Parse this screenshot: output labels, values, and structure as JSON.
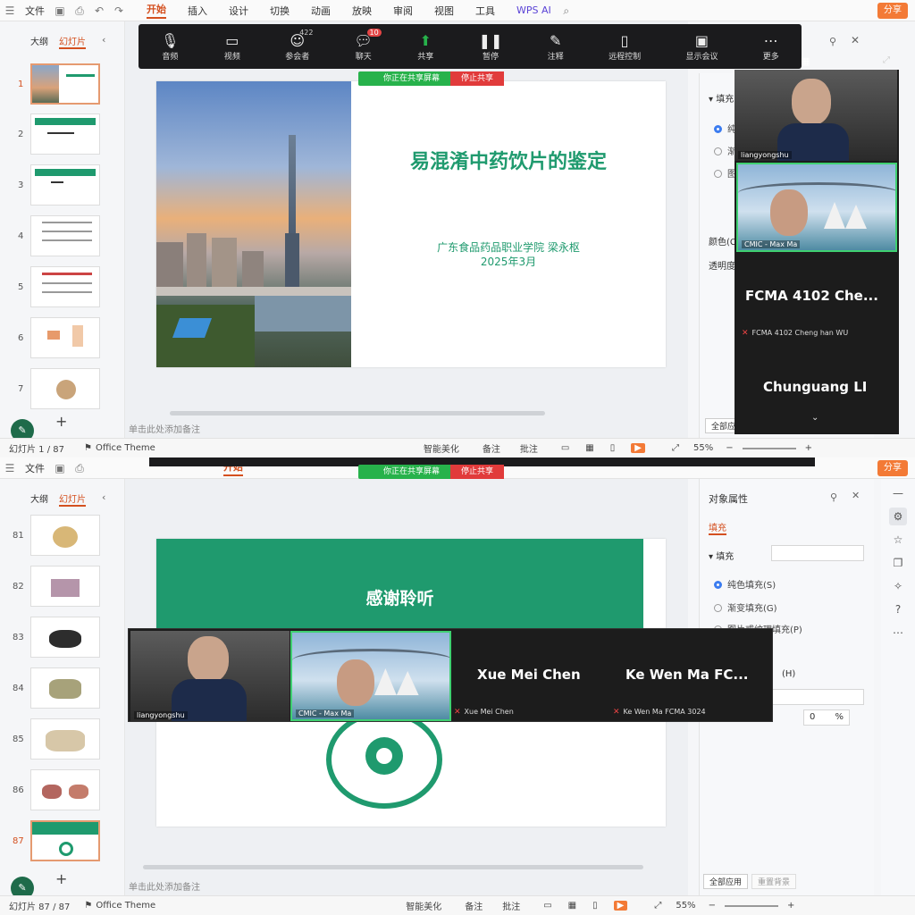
{
  "menubar": {
    "file": "文件",
    "items": [
      "开始",
      "插入",
      "设计",
      "切换",
      "动画",
      "放映",
      "审阅",
      "视图",
      "工具"
    ],
    "active": "开始",
    "wps_ai": "WPS AI",
    "share": "分享"
  },
  "sidebar": {
    "tab_outline": "大纲",
    "tab_slides": "幻灯片",
    "top_numbers": [
      "1",
      "2",
      "3",
      "4",
      "5",
      "6",
      "7"
    ],
    "bottom_numbers": [
      "81",
      "82",
      "83",
      "84",
      "85",
      "86",
      "87"
    ]
  },
  "zoom_toolbar": {
    "audio": "音频",
    "video": "视频",
    "participants": "参会者",
    "participants_count": "422",
    "chat": "聊天",
    "chat_badge": "10",
    "share": "共享",
    "pause": "暂停",
    "annotate": "注释",
    "remote": "远程控制",
    "show_meeting": "显示会议",
    "more": "更多"
  },
  "share_banner": {
    "sharing": "你正在共享屏幕",
    "stop": "停止共享"
  },
  "slide1": {
    "title": "易混淆中药饮片的鉴定",
    "org": "广东食品药品职业学院  梁永枢",
    "date": "2025年3月"
  },
  "slide87": {
    "title": "感谢聆听"
  },
  "notes_placeholder": "单击此处添加备注",
  "status_top": {
    "slide": "幻灯片 1 / 87",
    "theme": "Office Theme",
    "smart": "智能美化",
    "notes": "备注",
    "comment": "批注",
    "zoom": "55%"
  },
  "status_bottom": {
    "slide": "幻灯片 87 / 87",
    "theme": "Office Theme",
    "smart": "智能美化",
    "notes": "备注",
    "comment": "批注",
    "zoom": "55%"
  },
  "right_panel": {
    "title": "对象属性",
    "tab_fill": "填充",
    "section_fill": "填充",
    "opt_solid": "纯色填充(S)",
    "opt_gradient": "渐变填充(G)",
    "opt_picture": "图片或纹理填充(P)",
    "opt_h": "(H)",
    "color_label": "颜色(C)",
    "transparency_label": "透明度",
    "transparency_value": "0",
    "percent": "%",
    "apply_all": "全部应用",
    "reset_bg": "重置背景"
  },
  "participants_vertical": {
    "t1": "liangyongshu",
    "t2": "CMIC - Max Ma",
    "big3": "FCMA  4102  Che...",
    "small3": "FCMA 4102 Cheng han WU",
    "big4": "Chunguang LI"
  },
  "participants_horizontal": {
    "t1": "liangyongshu",
    "t2": "CMIC - Max Ma",
    "big3": "Xue Mei Chen",
    "small3": "Xue Mei Chen",
    "big4": "Ke Wen Ma FC...",
    "small4": "Ke Wen Ma FCMA 3024"
  },
  "colors": {
    "accent": "#d4501f",
    "green": "#1f9a6e",
    "zoom_green": "#27b24b",
    "zoom_red": "#e13b3b"
  }
}
